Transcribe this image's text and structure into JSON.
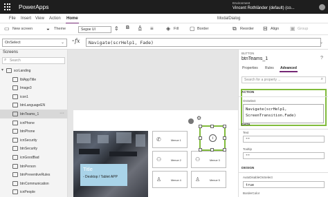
{
  "titlebar": {
    "app_name": "PowerApps",
    "environment_label": "Environment",
    "user": "Vincent Rothländer (default) (co..."
  },
  "menubar": {
    "items": [
      "File",
      "Insert",
      "View",
      "Action",
      "Home"
    ],
    "active": "Home",
    "document_name": "ModalDialog"
  },
  "toolbar": {
    "new_screen": "New screen",
    "theme": "Theme",
    "font": "Segoe UI",
    "fill": "Fill",
    "border": "Border",
    "reorder": "Reorder",
    "align": "Align",
    "group": "Group"
  },
  "formula_bar": {
    "property": "OnSelect",
    "equals": "=",
    "fx": "fx",
    "formula": "Navigate(scrHelp1, Fade)"
  },
  "screens_panel": {
    "title": "Screens",
    "search_placeholder": "Search",
    "items": [
      {
        "label": "scrLanding",
        "level": 0,
        "selected": false
      },
      {
        "label": "lblAppTitle",
        "level": 1,
        "selected": false
      },
      {
        "label": "Image3",
        "level": 1,
        "selected": false
      },
      {
        "label": "icon1",
        "level": 1,
        "selected": false
      },
      {
        "label": "btnLanguageEN",
        "level": 1,
        "selected": false
      },
      {
        "label": "btnTeams_1",
        "level": 1,
        "selected": true
      },
      {
        "label": "icnPhone",
        "level": 1,
        "selected": false
      },
      {
        "label": "btnPhone",
        "level": 1,
        "selected": false
      },
      {
        "label": "icnSecurity",
        "level": 1,
        "selected": false
      },
      {
        "label": "btnSecurity",
        "level": 1,
        "selected": false
      },
      {
        "label": "icnGoodBad",
        "level": 1,
        "selected": false
      },
      {
        "label": "btnPerson",
        "level": 1,
        "selected": false
      },
      {
        "label": "btnPreventiveRules",
        "level": 1,
        "selected": false
      },
      {
        "label": "btnCommunication",
        "level": 1,
        "selected": false
      },
      {
        "label": "icnPeople",
        "level": 1,
        "selected": false
      }
    ]
  },
  "canvas": {
    "hero_title": "Title",
    "hero_subtitle": "- Desktop / Tablet APP",
    "tiles": [
      {
        "label": "Menue 1",
        "icon": "phone-icon"
      },
      {
        "label": "Menue 2",
        "icon": "people-icon"
      },
      {
        "label": "Menue 3",
        "icon": "people-icon"
      },
      {
        "label": "Menue 4",
        "icon": "person-icon"
      },
      {
        "label": "Menue 5",
        "icon": "person-icon"
      }
    ],
    "help_icon": "i"
  },
  "properties_panel": {
    "type_label": "BUTTON",
    "name": "btnTeams_1",
    "tabs": [
      "Properties",
      "Rules",
      "Advanced"
    ],
    "active_tab": "Advanced",
    "search_placeholder": "Search for a property ...",
    "sections": {
      "action": "ACTION",
      "data": "DATA",
      "design": "DESIGN"
    },
    "onselect_label": "OnSelect",
    "onselect_line1": "Navigate(scrHelp1,",
    "onselect_line2": "ScreenTransition.Fade)",
    "text_label": "Text",
    "text_value": "\"\"",
    "tooltip_label": "Tooltip",
    "tooltip_value": "\"\"",
    "auto_disable_label": "AutoDisableOnSelect",
    "auto_disable_value": "true",
    "border_color_label": "BorderColor"
  },
  "colors": {
    "titlebar": "#1e1e1e",
    "accent": "#742774",
    "selection": "#80bb3a",
    "hero_card": "#a9d3e8"
  }
}
